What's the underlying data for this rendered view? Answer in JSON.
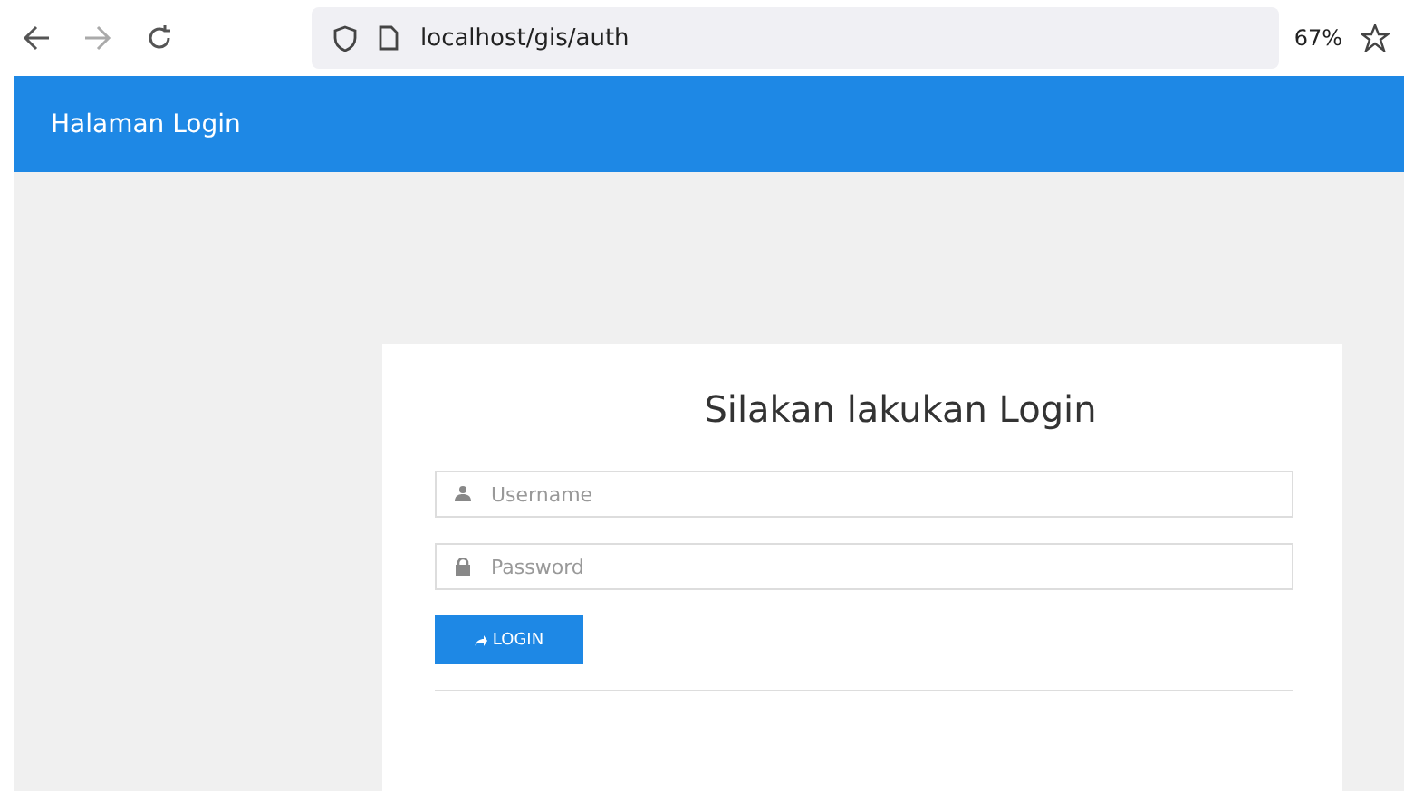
{
  "browser": {
    "url": "localhost/gis/auth",
    "zoom": "67%"
  },
  "header": {
    "title": "Halaman Login"
  },
  "login": {
    "title": "Silakan lakukan Login",
    "fields": [
      {
        "kind": "user",
        "placeholder": "Username"
      },
      {
        "kind": "lock",
        "placeholder": "Password"
      }
    ],
    "button": "LOGIN"
  }
}
